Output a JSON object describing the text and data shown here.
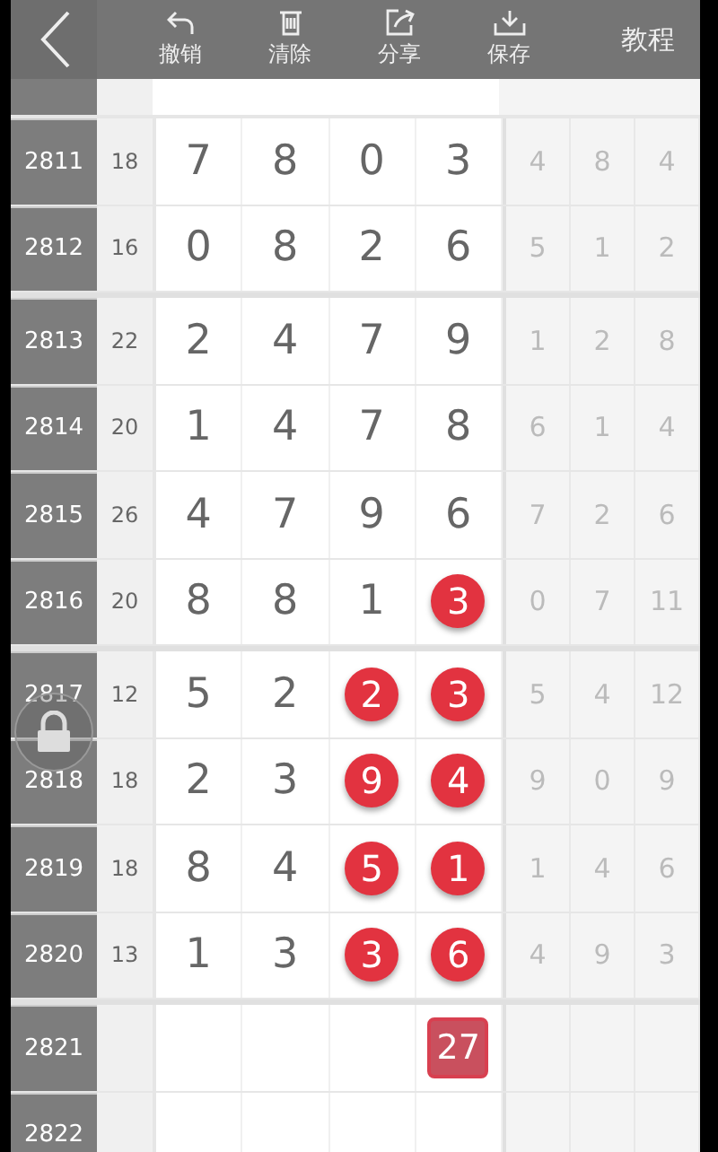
{
  "toolbar": {
    "actions": [
      {
        "label": "撤销",
        "kind": "undo"
      },
      {
        "label": "清除",
        "kind": "clear"
      },
      {
        "label": "分享",
        "kind": "share"
      },
      {
        "label": "保存",
        "kind": "save"
      }
    ],
    "tutorial": "教程"
  },
  "rows": [
    {
      "issue": "2811",
      "sum": "18",
      "group_start": false,
      "cells": [
        {
          "value": "7",
          "kind": "plain"
        },
        {
          "value": "8",
          "kind": "plain"
        },
        {
          "value": "0",
          "kind": "plain"
        },
        {
          "value": "3",
          "kind": "plain"
        }
      ],
      "stats": [
        "4",
        "8",
        "4"
      ]
    },
    {
      "issue": "2812",
      "sum": "16",
      "group_start": false,
      "cells": [
        {
          "value": "0",
          "kind": "plain"
        },
        {
          "value": "8",
          "kind": "plain"
        },
        {
          "value": "2",
          "kind": "plain"
        },
        {
          "value": "6",
          "kind": "plain"
        }
      ],
      "stats": [
        "5",
        "1",
        "2"
      ]
    },
    {
      "issue": "2813",
      "sum": "22",
      "group_start": true,
      "cells": [
        {
          "value": "2",
          "kind": "plain"
        },
        {
          "value": "4",
          "kind": "plain"
        },
        {
          "value": "7",
          "kind": "plain"
        },
        {
          "value": "9",
          "kind": "plain"
        }
      ],
      "stats": [
        "1",
        "2",
        "8"
      ]
    },
    {
      "issue": "2814",
      "sum": "20",
      "group_start": false,
      "cells": [
        {
          "value": "1",
          "kind": "plain"
        },
        {
          "value": "4",
          "kind": "plain"
        },
        {
          "value": "7",
          "kind": "plain"
        },
        {
          "value": "8",
          "kind": "plain"
        }
      ],
      "stats": [
        "6",
        "1",
        "4"
      ]
    },
    {
      "issue": "2815",
      "sum": "26",
      "group_start": false,
      "cells": [
        {
          "value": "4",
          "kind": "plain"
        },
        {
          "value": "7",
          "kind": "plain"
        },
        {
          "value": "9",
          "kind": "plain"
        },
        {
          "value": "6",
          "kind": "plain"
        }
      ],
      "stats": [
        "7",
        "2",
        "6"
      ]
    },
    {
      "issue": "2816",
      "sum": "20",
      "group_start": false,
      "cells": [
        {
          "value": "8",
          "kind": "plain"
        },
        {
          "value": "8",
          "kind": "plain"
        },
        {
          "value": "1",
          "kind": "plain"
        },
        {
          "value": "3",
          "kind": "ball"
        }
      ],
      "stats": [
        "0",
        "7",
        "11"
      ]
    },
    {
      "issue": "2817",
      "sum": "12",
      "group_start": true,
      "cells": [
        {
          "value": "5",
          "kind": "plain"
        },
        {
          "value": "2",
          "kind": "plain"
        },
        {
          "value": "2",
          "kind": "ball"
        },
        {
          "value": "3",
          "kind": "ball"
        }
      ],
      "stats": [
        "5",
        "4",
        "12"
      ]
    },
    {
      "issue": "2818",
      "sum": "18",
      "group_start": false,
      "cells": [
        {
          "value": "2",
          "kind": "plain"
        },
        {
          "value": "3",
          "kind": "plain"
        },
        {
          "value": "9",
          "kind": "ball"
        },
        {
          "value": "4",
          "kind": "ball"
        }
      ],
      "stats": [
        "9",
        "0",
        "9"
      ]
    },
    {
      "issue": "2819",
      "sum": "18",
      "group_start": false,
      "cells": [
        {
          "value": "8",
          "kind": "plain"
        },
        {
          "value": "4",
          "kind": "plain"
        },
        {
          "value": "5",
          "kind": "ball"
        },
        {
          "value": "1",
          "kind": "ball"
        }
      ],
      "stats": [
        "1",
        "4",
        "6"
      ]
    },
    {
      "issue": "2820",
      "sum": "13",
      "group_start": false,
      "cells": [
        {
          "value": "1",
          "kind": "plain"
        },
        {
          "value": "3",
          "kind": "plain"
        },
        {
          "value": "3",
          "kind": "ball"
        },
        {
          "value": "6",
          "kind": "ball"
        }
      ],
      "stats": [
        "4",
        "9",
        "3"
      ]
    },
    {
      "issue": "2821",
      "group_start": true,
      "cells": [
        {
          "kind": "empty"
        },
        {
          "kind": "empty"
        },
        {
          "kind": "empty"
        },
        {
          "value": "27",
          "kind": "box"
        }
      ],
      "stats": []
    },
    {
      "issue": "2822",
      "group_start": false,
      "cells": [
        {
          "kind": "empty"
        },
        {
          "kind": "empty"
        },
        {
          "kind": "empty"
        },
        {
          "kind": "empty"
        }
      ],
      "stats": []
    }
  ]
}
